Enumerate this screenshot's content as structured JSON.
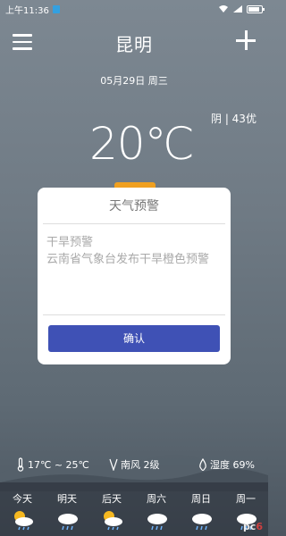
{
  "status_bar": {
    "time": "上午11:36",
    "notification_icon": "app-notification-icon",
    "right_icons": [
      "wifi-icon",
      "signal-icon",
      "battery-icon"
    ]
  },
  "header": {
    "menu_icon": "menu-icon",
    "city": "昆明",
    "add_icon": "plus-icon"
  },
  "date": "05月29日 周三",
  "current": {
    "temperature": "20℃",
    "condition_aqi": "阴 | 43优"
  },
  "dialog": {
    "title": "天气预警",
    "body": "干旱预警\n云南省气象台发布干旱橙色预警",
    "confirm_label": "确认"
  },
  "summary": {
    "temp_range": "17℃ ~ 25℃",
    "wind": "南风 2级",
    "humidity": "湿度 69%"
  },
  "forecast": [
    {
      "day": "今天",
      "icon": "sun-cloud-rain-icon"
    },
    {
      "day": "明天",
      "icon": "cloud-rain-icon"
    },
    {
      "day": "后天",
      "icon": "sun-cloud-rain-icon"
    },
    {
      "day": "周六",
      "icon": "cloud-rain-icon"
    },
    {
      "day": "周日",
      "icon": "cloud-rain-icon"
    },
    {
      "day": "周一",
      "icon": "cloud-rain-icon"
    }
  ],
  "watermark": {
    "prefix": "pc",
    "suffix": "6"
  },
  "colors": {
    "confirm_button": "#3f51b5",
    "accent_tab": "#f0a020",
    "sun": "#f5b820"
  }
}
